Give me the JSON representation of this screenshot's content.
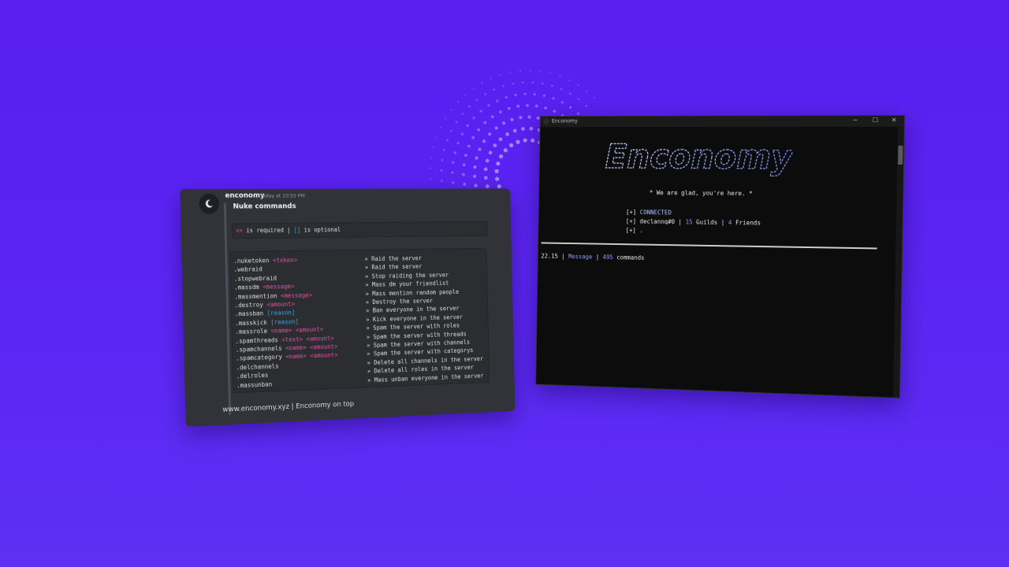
{
  "discord": {
    "username": "enconomy",
    "timestamp": "Today at 10:55 PM",
    "embed_title": "Nuke commands",
    "legend": {
      "req_symbol": "<>",
      "req_text": "is required",
      "sep": "|",
      "opt_symbol": "[]",
      "opt_text": "is optional"
    },
    "commands": [
      {
        "name": ".nuketoken",
        "args": [
          {
            "t": "<token>",
            "k": "req"
          }
        ],
        "desc": "» Raid the server"
      },
      {
        "name": ".webraid",
        "args": [],
        "desc": "» Raid the server"
      },
      {
        "name": ".stopwebraid",
        "args": [],
        "desc": "» Stop raiding the server"
      },
      {
        "name": ".massdm",
        "args": [
          {
            "t": "<message>",
            "k": "req"
          }
        ],
        "desc": "» Mass dm your friendlist"
      },
      {
        "name": ".massmention",
        "args": [
          {
            "t": "<message>",
            "k": "req"
          }
        ],
        "desc": "» Mass mention random people"
      },
      {
        "name": ".destroy",
        "args": [
          {
            "t": "<amount>",
            "k": "req"
          }
        ],
        "desc": "» Destroy the server"
      },
      {
        "name": ".massban",
        "args": [
          {
            "t": "[reason]",
            "k": "opt"
          }
        ],
        "desc": "» Ban everyone in the server"
      },
      {
        "name": ".masskick",
        "args": [
          {
            "t": "[reason]",
            "k": "opt"
          }
        ],
        "desc": "» Kick everyone in the server"
      },
      {
        "name": ".massrole",
        "args": [
          {
            "t": "<name>",
            "k": "req"
          },
          {
            "t": "<amount>",
            "k": "req"
          }
        ],
        "desc": "» Spam the server with roles"
      },
      {
        "name": ".spamthreads",
        "args": [
          {
            "t": "<text>",
            "k": "req"
          },
          {
            "t": "<amount>",
            "k": "req"
          }
        ],
        "desc": "» Spam the server with threads"
      },
      {
        "name": ".spamchannels",
        "args": [
          {
            "t": "<name>",
            "k": "req"
          },
          {
            "t": "<amount>",
            "k": "req"
          }
        ],
        "desc": "» Spam the server with channels"
      },
      {
        "name": ".spamcategory",
        "args": [
          {
            "t": "<name>",
            "k": "req"
          },
          {
            "t": "<amount>",
            "k": "req"
          }
        ],
        "desc": "» Spam the server with categorys"
      },
      {
        "name": ".delchannels",
        "args": [],
        "desc": "» Delete all channels in the server"
      },
      {
        "name": ".delroles",
        "args": [],
        "desc": "» Delete all roles in the server"
      },
      {
        "name": ".massunban",
        "args": [],
        "desc": "» Mass unban everyone in the server"
      }
    ],
    "footer": "www.enconomy.xyz | Enconomy on top"
  },
  "console": {
    "window_title": "Enconomy",
    "btn_min": "─",
    "btn_max": "☐",
    "btn_close": "✕",
    "logo_text": "Enconomy",
    "tagline": "* We are glad, you're here. *",
    "line1_prefix": "[+]",
    "line1_text": "CONNECTED",
    "line2_prefix": "[+]",
    "line2_user": "declannq#0",
    "line2_sep1": "|",
    "line2_guilds_count": "15",
    "line2_guilds_label": "Guilds",
    "line2_sep2": "|",
    "line2_friends_count": "4",
    "line2_friends_label": "Friends",
    "line3_prefix": "[+]",
    "line3_text": ".",
    "status_time": "22.15",
    "status_sep1": "|",
    "status_mode": "Message",
    "status_sep2": "|",
    "status_count": "495",
    "status_label": "commands"
  },
  "colors": {
    "background": "#5a1ef0",
    "required": "#e34fa3",
    "optional": "#3ba2e6",
    "console_accent": "#8a9cff"
  }
}
